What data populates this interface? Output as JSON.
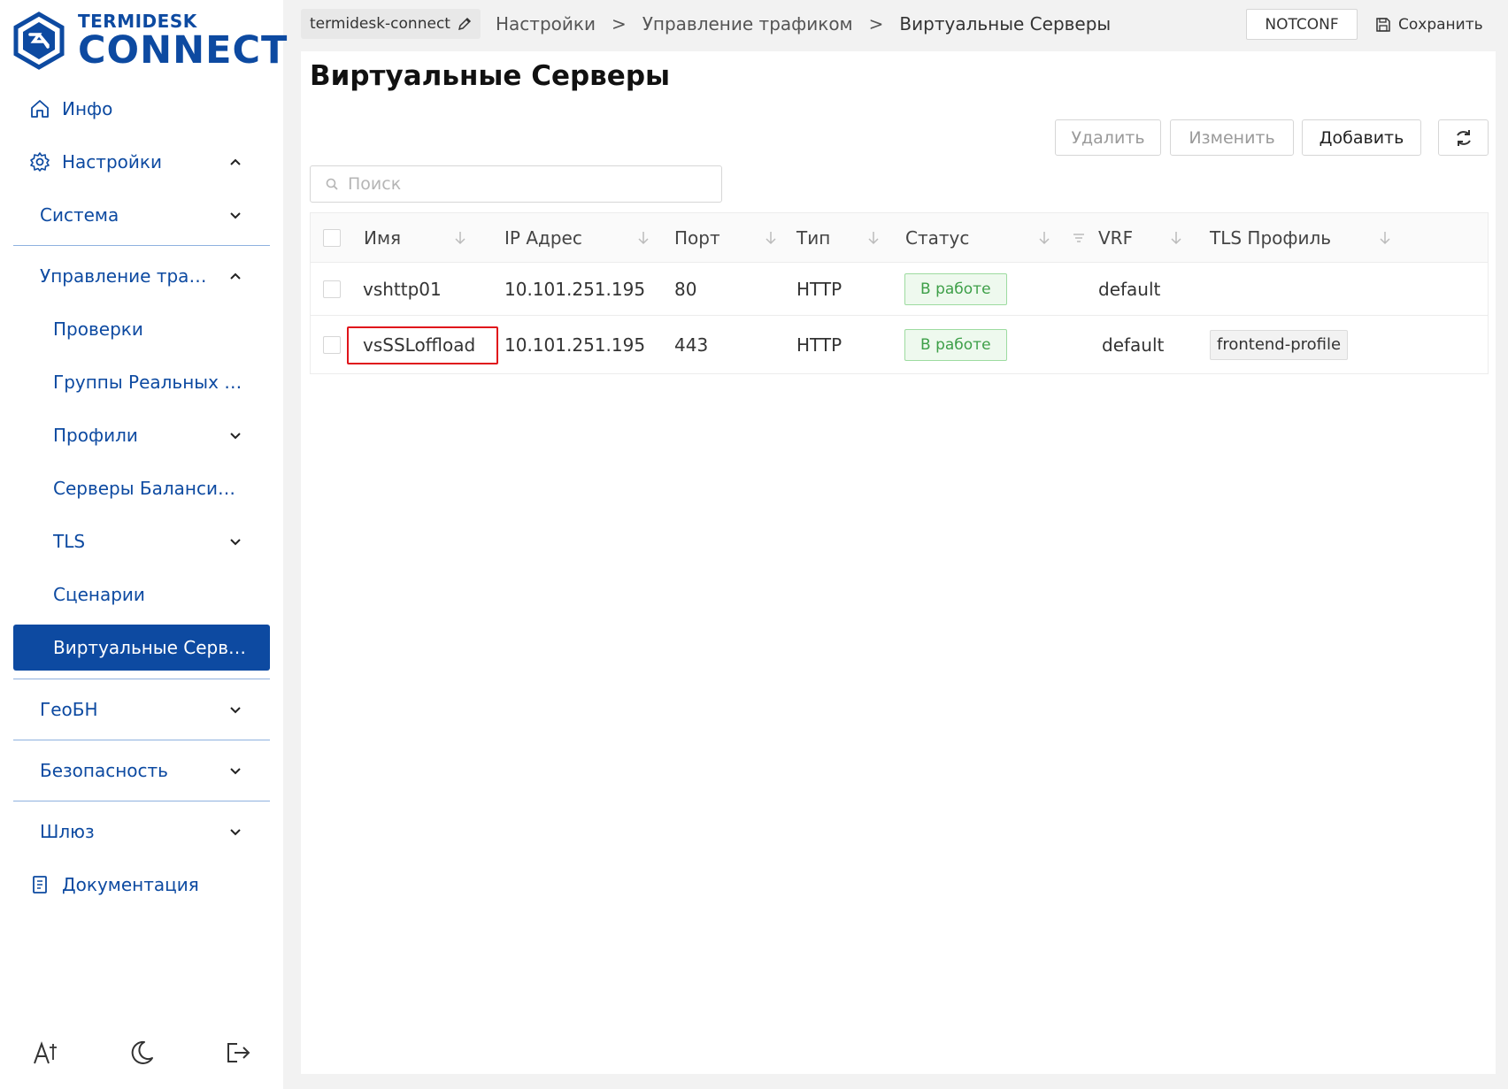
{
  "brand": {
    "small": "TERMIDESK",
    "big": "CONNECT",
    "color": "#0d4aa1"
  },
  "sidebar": {
    "info": "Инфо",
    "settings": "Настройки",
    "system": "Система",
    "traffic": "Управление трафиком",
    "checks": "Проверки",
    "real_groups": "Группы Реальных Серверов",
    "profiles": "Профили",
    "balancers": "Серверы Балансировки",
    "tls": "TLS",
    "scenarios": "Сценарии",
    "virtual_servers": "Виртуальные Серверы",
    "geo": "ГеоБН",
    "security": "Безопасность",
    "gateway": "Шлюз",
    "docs": "Документация"
  },
  "topbar": {
    "project": "termidesk-connect",
    "crumbs": [
      "Настройки",
      "Управление трафиком",
      "Виртуальные Серверы"
    ],
    "notconf": "NOTCONF",
    "save": "Сохранить"
  },
  "page": {
    "title": "Виртуальные Серверы",
    "delete": "Удалить",
    "edit": "Изменить",
    "add": "Добавить",
    "search_placeholder": "Поиск"
  },
  "table": {
    "columns": {
      "name": "Имя",
      "ip": "IP Адрес",
      "port": "Порт",
      "type": "Тип",
      "status": "Статус",
      "vrf": "VRF",
      "tls": "TLS Профиль"
    },
    "rows": [
      {
        "name": "vshttp01",
        "ip": "10.101.251.195",
        "port": "80",
        "type": "HTTP",
        "status": "В работе",
        "vrf": "default",
        "tls": ""
      },
      {
        "name": "vsSSLoffload",
        "ip": "10.101.251.195",
        "port": "443",
        "type": "HTTP",
        "status": "В работе",
        "vrf": "default",
        "tls": "frontend-profile"
      }
    ]
  }
}
